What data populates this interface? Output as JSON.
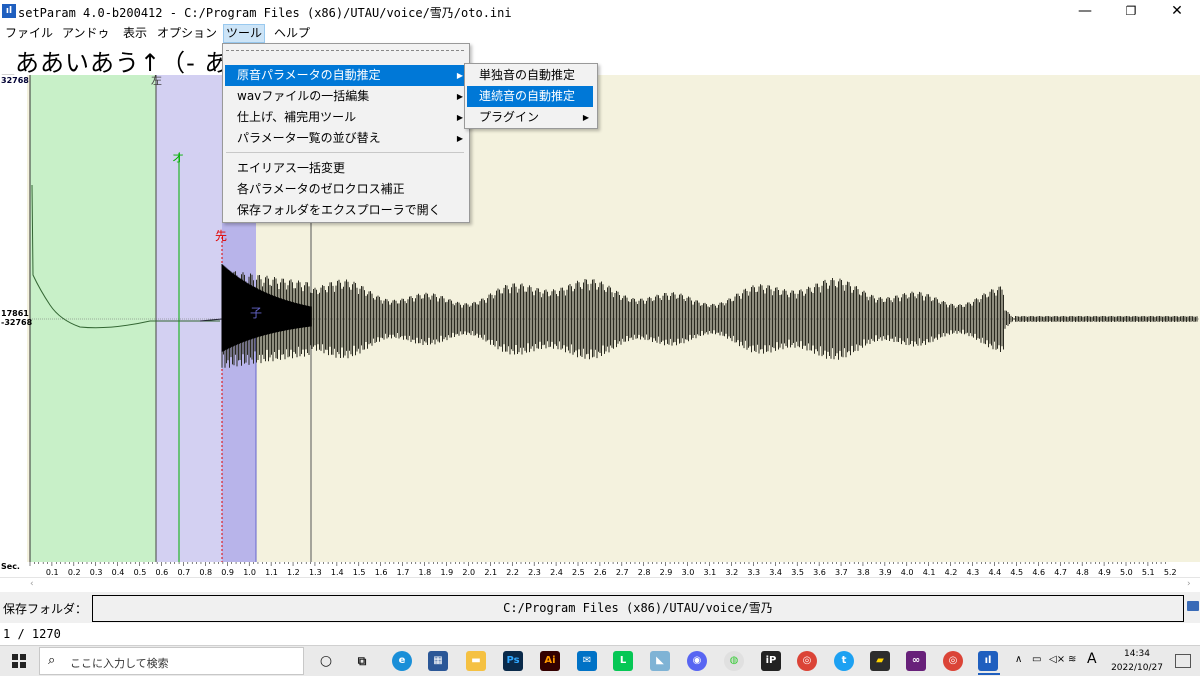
{
  "window": {
    "title": "setParam 4.0-b200412 -  C:/Program Files (x86)/UTAU/voice/雪乃/oto.ini",
    "app_icon": "setparam-icon",
    "minimize": "—",
    "maximize": "❐",
    "close": "✕"
  },
  "menubar": {
    "items": [
      {
        "label": "ファイル"
      },
      {
        "label": "アンドゥ"
      },
      {
        "label": "表示"
      },
      {
        "label": "オプション"
      },
      {
        "label": "ツール"
      },
      {
        "label": "ヘルプ"
      }
    ]
  },
  "alias": {
    "text": "_ああいあう↑（-  あ"
  },
  "tools_menu": {
    "items": [
      {
        "label": "原音パラメータの自動推定",
        "has_submenu": true
      },
      {
        "label": "wavファイルの一括編集",
        "has_submenu": true
      },
      {
        "label": "仕上げ、補完用ツール",
        "has_submenu": true
      },
      {
        "label": "パラメータ一覧の並び替え",
        "has_submenu": true
      },
      {
        "label": "エイリアス一括変更",
        "has_submenu": false
      },
      {
        "label": "各パラメータのゼロクロス補正",
        "has_submenu": false
      },
      {
        "label": "保存フォルダをエクスプローラで開く",
        "has_submenu": false
      }
    ]
  },
  "submenu": {
    "items": [
      {
        "label": "単独音の自動推定",
        "has_submenu": false
      },
      {
        "label": "連続音の自動推定",
        "has_submenu": false
      },
      {
        "label": "プラグイン",
        "has_submenu": true
      }
    ]
  },
  "markers": {
    "left": "左",
    "overlap": "オ",
    "preutterance": "先",
    "consonant": "子"
  },
  "scale": {
    "top": "32768",
    "mid_top": "17861",
    "mid_bottom": "-32768",
    "sec_label": "Sec."
  },
  "ruler_ticks": [
    "0.1",
    "0.2",
    "0.3",
    "0.4",
    "0.5",
    "0.6",
    "0.7",
    "0.8",
    "0.9",
    "1.0",
    "1.1",
    "1.2",
    "1.3",
    "1.4",
    "1.5",
    "1.6",
    "1.7",
    "1.8",
    "1.9",
    "2.0",
    "2.1",
    "2.2",
    "2.3",
    "2.4",
    "2.5",
    "2.6",
    "2.7",
    "2.8",
    "2.9",
    "3.0",
    "3.1",
    "3.2",
    "3.3",
    "3.4",
    "3.5",
    "3.6",
    "3.7",
    "3.8",
    "3.9",
    "4.0",
    "4.1",
    "4.2",
    "4.3",
    "4.4",
    "4.5",
    "4.6",
    "4.7",
    "4.8",
    "4.9",
    "5.0",
    "5.1",
    "5.2"
  ],
  "folder": {
    "label": "保存フォルダ：",
    "path": "C:/Program Files (x86)/UTAU/voice/雪乃"
  },
  "status": {
    "text": "1  /  1270"
  },
  "taskbar": {
    "search_placeholder": "ここに入力して検索",
    "time": "14:34",
    "date": "2022/10/27",
    "ime": "A"
  },
  "colors": {
    "left_blank": "#c8f0c8",
    "consonant_region": "#d3d0f2",
    "waveform_bg": "#f4f2de",
    "menu_highlight": "#0078d7"
  }
}
